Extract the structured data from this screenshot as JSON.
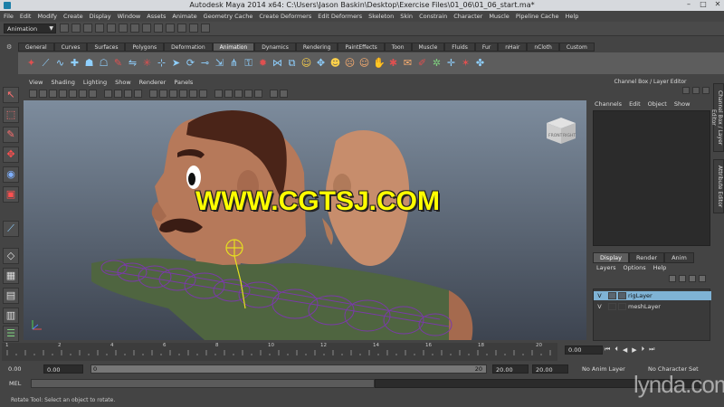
{
  "window": {
    "title": "Autodesk Maya 2014 x64: C:\\Users\\Jason Baskin\\Desktop\\Exercise Files\\01_06\\01_06_start.ma*",
    "minimize": "–",
    "maximize": "□",
    "close": "✕"
  },
  "menubar": {
    "items": [
      "File",
      "Edit",
      "Modify",
      "Create",
      "Display",
      "Window",
      "Assets",
      "Animate",
      "Geometry Cache",
      "Create Deformers",
      "Edit Deformers",
      "Skeleton",
      "Skin",
      "Constrain",
      "Character",
      "Muscle",
      "Pipeline Cache",
      "Help"
    ]
  },
  "status_line": {
    "mode": "Animation"
  },
  "shelf": {
    "tabs": [
      "General",
      "Curves",
      "Surfaces",
      "Polygons",
      "Deformation",
      "Animation",
      "Dynamics",
      "Rendering",
      "PaintEffects",
      "Toon",
      "Muscle",
      "Fluids",
      "Fur",
      "nHair",
      "nCloth",
      "Custom"
    ],
    "active_tab": "Animation"
  },
  "viewport": {
    "menu": [
      "View",
      "Shading",
      "Lighting",
      "Show",
      "Renderer",
      "Panels"
    ],
    "viewcube_front": "FRONT",
    "viewcube_right": "RIGHT",
    "watermark": "WWW.CGTSJ.COM"
  },
  "channel_box": {
    "title": "Channel Box / Layer Editor",
    "menu": [
      "Channels",
      "Edit",
      "Object",
      "Show"
    ],
    "layer_tabs": [
      "Display",
      "Render",
      "Anim"
    ],
    "active_layer_tab": "Display",
    "layer_menu": [
      "Layers",
      "Options",
      "Help"
    ],
    "layers": [
      {
        "visible": "V",
        "name": "rigLayer",
        "selected": true
      },
      {
        "visible": "V",
        "name": "meshLayer",
        "selected": false
      }
    ],
    "side_tabs": [
      "Channel Box / Layer Editor",
      "Attribute Editor"
    ]
  },
  "time_slider": {
    "ticks": [
      "1",
      "2",
      "4",
      "6",
      "8",
      "10",
      "12",
      "14",
      "16",
      "18",
      "20"
    ],
    "current_frame": "0.00",
    "playback": [
      "⏮",
      "⏴",
      "◀",
      "▶",
      "⏵",
      "⏭"
    ]
  },
  "range_slider": {
    "start_time": "0.00",
    "playback_start": "0.00",
    "range_start_label": "0",
    "range_end_label": "20",
    "playback_end": "20.00",
    "end_time": "20.00",
    "anim_layer": "No Anim Layer",
    "character_set": "No Character Set"
  },
  "command_line": {
    "label": "MEL"
  },
  "help_line": {
    "text": "Rotate Tool: Select an object to rotate."
  },
  "branding": {
    "lynda": "lynda.com"
  }
}
